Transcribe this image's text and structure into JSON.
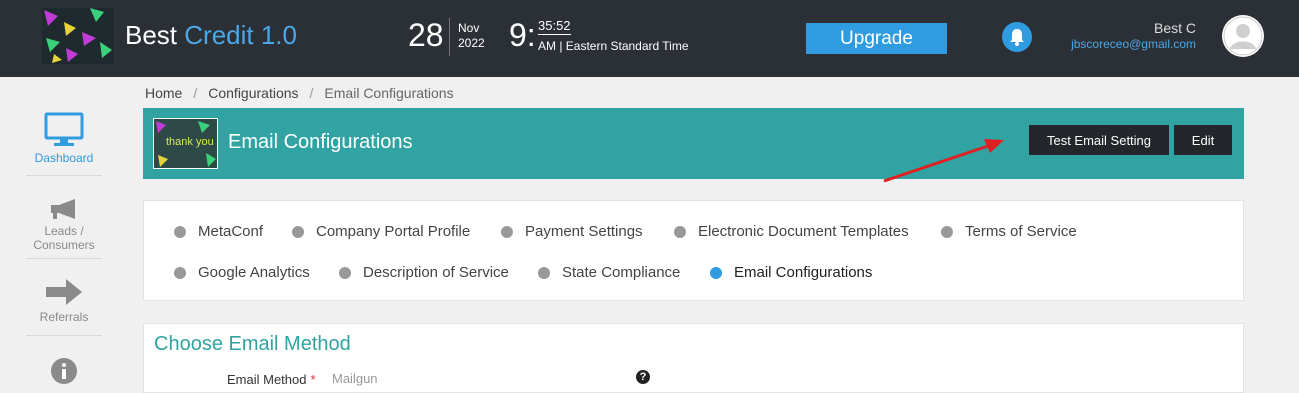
{
  "brand": {
    "name_part1": "Best",
    "name_part2": "Credit 1.0"
  },
  "datetime": {
    "day": "28",
    "month": "Nov",
    "year": "2022",
    "hour": "9:",
    "hms": "35:52",
    "meridiem_tz": "AM | Eastern Standard Time"
  },
  "header": {
    "upgrade_label": "Upgrade",
    "user_name": "Best C",
    "user_email": "jbscoreceo@gmail.com"
  },
  "sidebar": {
    "items": [
      {
        "label": "Dashboard",
        "icon": "monitor-icon",
        "active": true
      },
      {
        "label": "Leads / Consumers",
        "icon": "megaphone-icon",
        "active": false
      },
      {
        "label": "Referrals",
        "icon": "arrow-right-icon",
        "active": false
      },
      {
        "label": "",
        "icon": "info-icon",
        "active": false
      }
    ]
  },
  "breadcrumb": [
    "Home",
    "Configurations",
    "Email Configurations"
  ],
  "page": {
    "title": "Email Configurations",
    "thumb_text": "thank you",
    "test_button": "Test Email Setting",
    "edit_button": "Edit"
  },
  "tabs": [
    {
      "label": "MetaConf"
    },
    {
      "label": "Company Portal Profile"
    },
    {
      "label": "Payment Settings"
    },
    {
      "label": "Electronic Document Templates"
    },
    {
      "label": "Terms of Service"
    },
    {
      "label": "Google Analytics"
    },
    {
      "label": "Description of Service"
    },
    {
      "label": "State Compliance"
    },
    {
      "label": "Email Configurations",
      "active": true
    }
  ],
  "method": {
    "title": "Choose Email Method",
    "field_label": "Email Method",
    "required_mark": "*",
    "field_value": "Mailgun"
  },
  "colors": {
    "topbar": "#2b3037",
    "accent_blue": "#2f9be0",
    "teal": "#31a3a2",
    "annotation_arrow": "#e02020"
  }
}
